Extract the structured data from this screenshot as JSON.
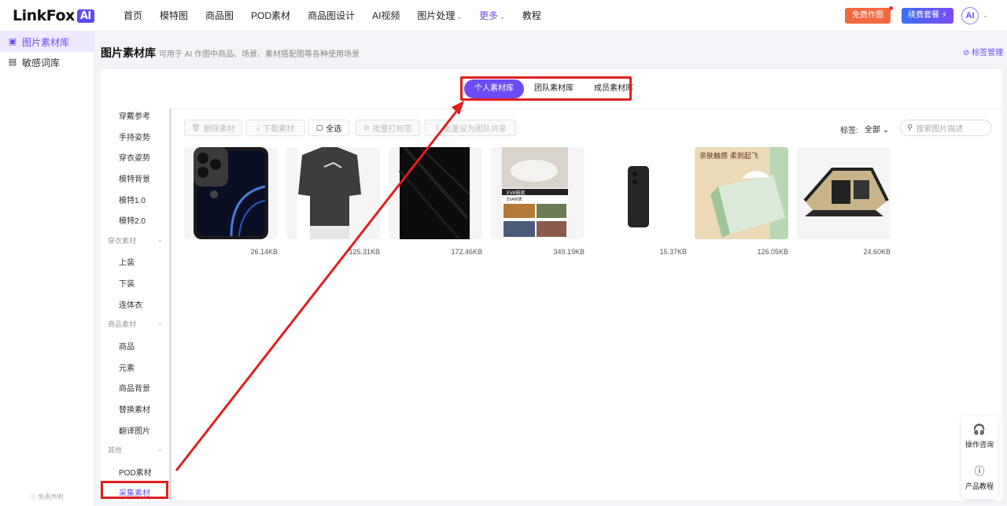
{
  "header": {
    "logo_text": "LinkFox",
    "logo_badge": "AI",
    "nav": [
      {
        "label": "首页"
      },
      {
        "label": "模特图"
      },
      {
        "label": "商品图"
      },
      {
        "label": "POD素材"
      },
      {
        "label": "商品图设计"
      },
      {
        "label": "AI视频"
      },
      {
        "label": "图片处理",
        "chevron": "⌄"
      },
      {
        "label": "更多",
        "chevron": "⌄"
      },
      {
        "label": "教程"
      }
    ],
    "free_button": "免费作图",
    "renew_button": "续费套餐 ⚡",
    "avatar": "AI"
  },
  "sidebar": {
    "items": [
      {
        "label": "图片素材库",
        "icon": "image-library-icon"
      },
      {
        "label": "敏感词库",
        "icon": "word-library-icon"
      }
    ],
    "disclaimer": "ⓘ 免责声明"
  },
  "page": {
    "title": "图片素材库",
    "description": "可用于 AI 作图中商品、场景、素材搭配图等各种使用场景",
    "tag_manage": "标签管理"
  },
  "tabs": [
    {
      "label": "个人素材库"
    },
    {
      "label": "团队素材库"
    },
    {
      "label": "成员素材库"
    }
  ],
  "categories": [
    {
      "label": "穿戴参考"
    },
    {
      "label": "手持姿势"
    },
    {
      "label": "穿衣姿势"
    },
    {
      "label": "模特背景"
    },
    {
      "label": "模特1.0"
    },
    {
      "label": "模特2.0"
    },
    {
      "label": "穿衣素材"
    },
    {
      "label": "上装"
    },
    {
      "label": "下装"
    },
    {
      "label": "连体衣"
    },
    {
      "label": "商品素材"
    },
    {
      "label": "商品"
    },
    {
      "label": "元素"
    },
    {
      "label": "商品背景"
    },
    {
      "label": "替换素材"
    },
    {
      "label": "翻译图片"
    },
    {
      "label": "其他"
    },
    {
      "label": "POD素材"
    },
    {
      "label": "采集素材"
    }
  ],
  "toolbar": {
    "delete": "删除素材",
    "download": "下载素材",
    "select_all": "全选",
    "batch_tag": "批量打标签",
    "batch_share": "批量设为团队共享",
    "tag_label": "标签:",
    "tag_value": "全部",
    "search_placeholder": "搜索图片描述"
  },
  "cards": [
    {
      "size": "26.14KB"
    },
    {
      "size": "125.31KB"
    },
    {
      "size": "172.46KB"
    },
    {
      "size": "349.19KB",
      "text_a": "EVA鞋款",
      "text_b": "EVA材质"
    },
    {
      "size": "15.37KB"
    },
    {
      "size": "126.05KB",
      "text_a": "亲肤触感  柔到起飞"
    },
    {
      "size": "24.60KB"
    }
  ],
  "float": {
    "support": "操作咨询",
    "tutorial": "产品教程"
  },
  "colors": {
    "accent": "#6d4cf6",
    "highlight": "#e01f1f",
    "free": "#f5673f"
  }
}
